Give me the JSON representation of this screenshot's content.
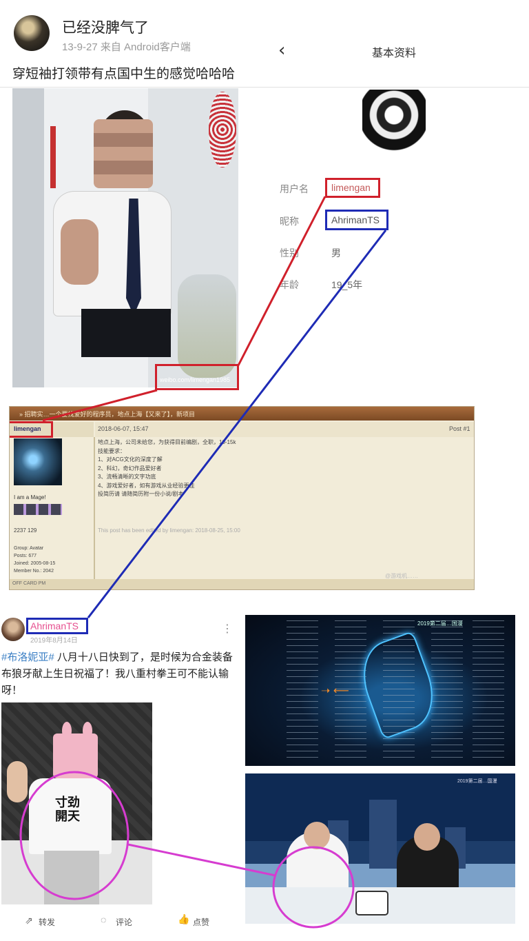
{
  "weibo": {
    "poster_name": "已经没脾气了",
    "meta": "13-9-27  来自 Android客户端",
    "post_text": "穿短袖打领带有点国中生的感觉哈哈哈",
    "watermark": "weibo.com/limengan1985"
  },
  "profile": {
    "back_icon": "back-icon",
    "title": "基本资料",
    "fields": [
      {
        "label": "用户名",
        "value": "limengan"
      },
      {
        "label": "昵称",
        "value": "AhrimanTS"
      },
      {
        "label": "性别",
        "value": "男"
      },
      {
        "label": "年龄",
        "value": "19_5年"
      }
    ]
  },
  "forum": {
    "title": "» 招聘实…一个要找爱好的程序员，地点上海【又来了】，新项目",
    "username": "limengan",
    "date": "2018-06-07, 15:47",
    "post_num": "Post #1",
    "user_title": "I am a Mage!",
    "stats": "2237   129",
    "info": [
      "Group: Avatar",
      "Posts: 677",
      "Joined: 2005-08-15",
      "Member No.: 2042"
    ],
    "body": [
      "地点上海，公司未给您，为获得目前编剧，全职，10-15k",
      "",
      "技能要求：",
      "1、对ACG文化的深度了解",
      "2、科幻，奇幻作品爱好者",
      "3、流畅清晰的文字功底",
      "4、游戏爱好者，如有游戏从业经验更佳",
      "",
      "投简历请          请随简历附一份小说/剧本"
    ],
    "edited": "This post has been edited by limengan: 2018-08-25, 15:00",
    "footer_left": "OFF  CARD  PM",
    "watermark": "@游戏机……"
  },
  "bili": {
    "name": "AhrimanTS",
    "date": "2019年8月14日",
    "text_tag": "#布洛妮亚#",
    "text_body": " 八月十八日快到了，是时候为合金装备布狼牙献上生日祝福了！我八重村拳王可不能认输呀！",
    "shirt_text": "寸劲\n開天",
    "frame1_caption": "2019第二届…国漫",
    "frame2_caption": "2019第二届…国漫",
    "actions": {
      "share": "转发",
      "comment": "评论",
      "like": "点赞"
    }
  },
  "colors": {
    "red_box": "#d0202b",
    "blue_box": "#1e2bb5",
    "magenta": "#d63cd0"
  }
}
